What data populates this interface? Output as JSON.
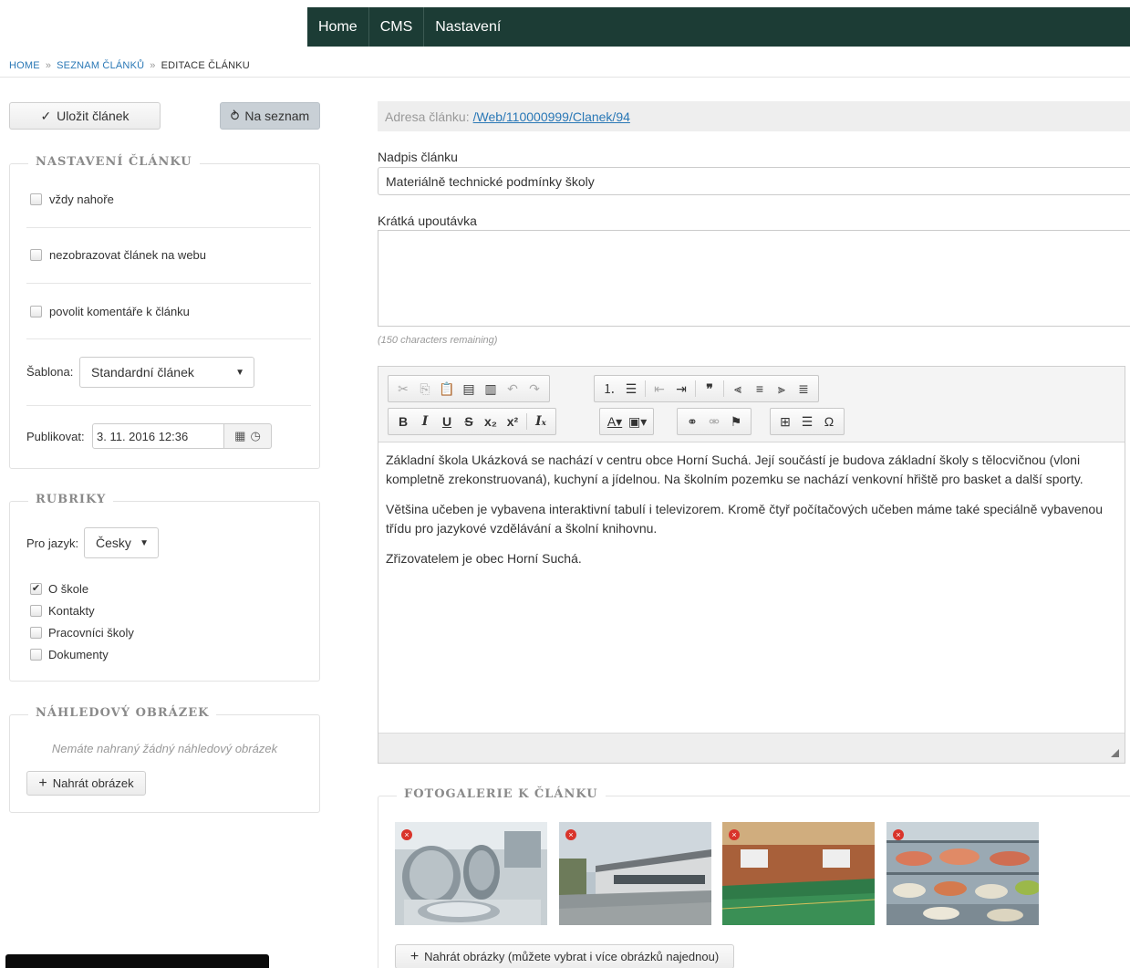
{
  "nav": {
    "items": [
      "Home",
      "CMS",
      "Nastavení"
    ]
  },
  "breadcrumb": {
    "home": "HOME",
    "sep": "»",
    "list": "SEZNAM ČLÁNKŮ",
    "current": "EDITACE ČLÁNKU"
  },
  "actions": {
    "save": "Uložit článek",
    "back": "Na seznam"
  },
  "settings": {
    "legend": "NASTAVENÍ ČLÁNKU",
    "always_top": "vždy nahoře",
    "hide_on_web": "nezobrazovat článek na webu",
    "allow_comments": "povolit komentáře k článku",
    "template_label": "Šablona:",
    "template_value": "Standardní článek",
    "publish_label": "Publikovat:",
    "publish_value": "3. 11. 2016 12:36"
  },
  "categories": {
    "legend": "RUBRIKY",
    "lang_label": "Pro jazyk:",
    "lang_value": "Česky",
    "items": [
      {
        "label": "O škole",
        "checked": true
      },
      {
        "label": "Kontakty",
        "checked": false
      },
      {
        "label": "Pracovníci školy",
        "checked": false
      },
      {
        "label": "Dokumenty",
        "checked": false
      }
    ]
  },
  "preview": {
    "legend": "NÁHLEDOVÝ OBRÁZEK",
    "empty": "Nemáte nahraný žádný náhledový obrázek",
    "upload": "Nahrát obrázek"
  },
  "article": {
    "url_label": "Adresa článku:",
    "url": "/Web/110000999/Clanek/94",
    "title_label": "Nadpis článku",
    "title_value": "Materiálně technické podmínky školy",
    "teaser_label": "Krátká upoutávka",
    "teaser_value": "",
    "remaining": "(150 characters remaining)"
  },
  "editor": {
    "paragraphs": [
      "Základní škola Ukázková se nachází v centru obce Horní Suchá. Její součástí je budova základní školy s tělocvičnou (vloni kompletně zrekonstruovaná), kuchyní a jídelnou. Na školním pozemku se nachází venkovní hřiště pro basket a další sporty.",
      "Většina učeben je vybavena interaktivní tabulí i televizorem.  Kromě čtyř počítačových učeben máme také speciálně vybavenou třídu pro jazykové vzdělávání a školní knihovnu.",
      "Zřizovatelem je obec Horní Suchá."
    ]
  },
  "gallery": {
    "legend": "FOTOGALERIE K ČLÁNKU",
    "photos": [
      "kitchen-photo",
      "school-building-photo",
      "gym-photo",
      "canteen-food-photo"
    ],
    "upload": "Nahrát obrázky (můžete vybrat i více obrázků najednou)"
  },
  "colors": {
    "nav_bg": "#1c3c35",
    "link": "#2a78b6",
    "delete": "#d9342b"
  }
}
